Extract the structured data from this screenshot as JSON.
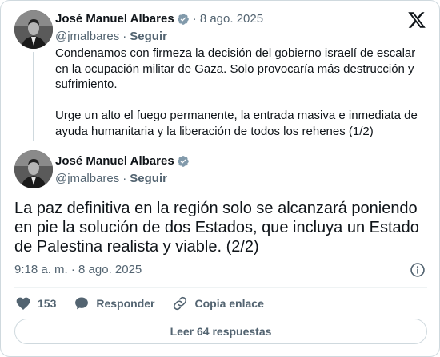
{
  "first_tweet": {
    "author_name": "José Manuel Albares",
    "date": "· 8 ago. 2025",
    "handle": "@jmalbares",
    "separator": "·",
    "follow_label": "Seguir",
    "paragraphs": [
      "Condenamos con firmeza la decisión del gobierno israelí de escalar en la ocupación militar de Gaza. Solo provocaría más destrucción y sufrimiento.",
      "Urge un alto el fuego permanente, la entrada masiva e inmediata de ayuda humanitaria y la liberación de todos los rehenes (1/2)"
    ]
  },
  "second_tweet": {
    "author_name": "José Manuel Albares",
    "handle": "@jmalbares",
    "separator": "·",
    "follow_label": "Seguir",
    "text": "La paz definitiva en la región solo se alcanzará poniendo en pie la solución de dos Estados, que incluya un Estado de Palestina realista y viable. (2/2)",
    "timestamp": "9:18 a. m. · 8 ago. 2025"
  },
  "actions": {
    "like_count": "153",
    "reply_label": "Responder",
    "copy_label": "Copia enlace"
  },
  "read_replies_label": "Leer 64 respuestas",
  "icons": {
    "brand": "x-logo-icon",
    "verified": "verified-badge-icon",
    "info": "info-icon",
    "like": "heart-icon",
    "reply": "speech-bubble-icon",
    "link": "link-icon"
  },
  "colors": {
    "text": "#0f1419",
    "secondary": "#536471",
    "border": "#cfd9de"
  }
}
